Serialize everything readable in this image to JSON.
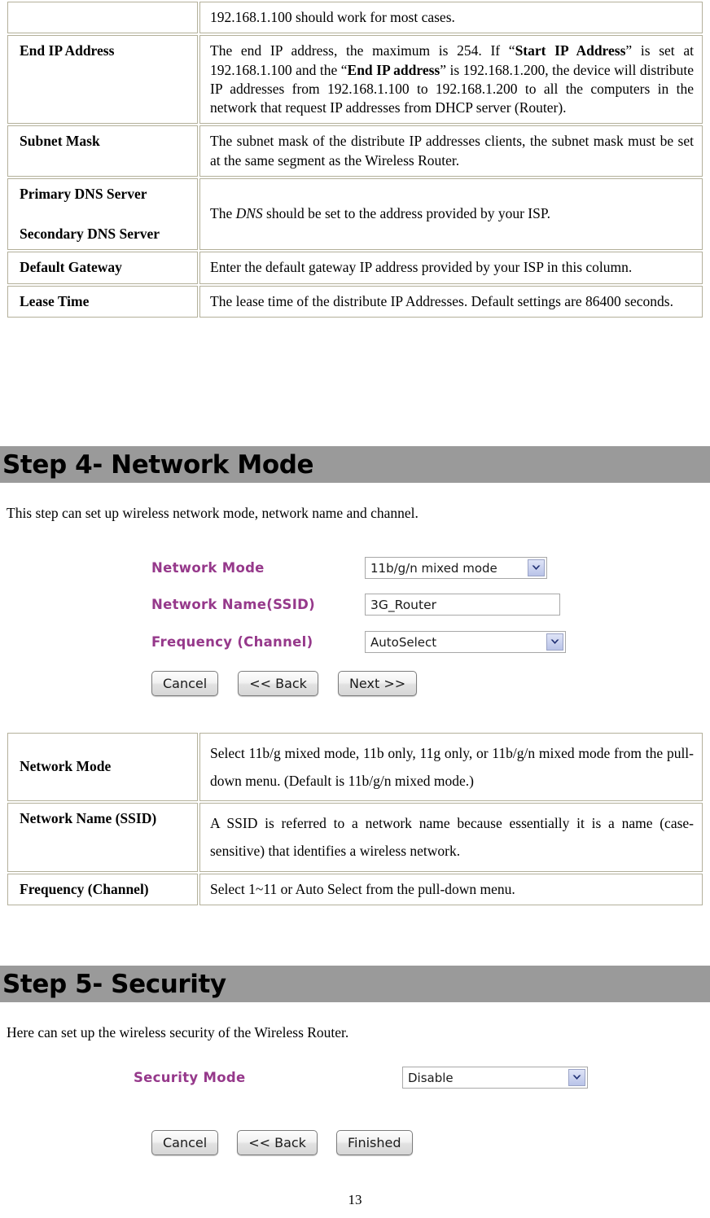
{
  "dhcp_table": {
    "rows": [
      {
        "label": "",
        "desc_html": "192.168.1.100 should work for most cases."
      },
      {
        "label": "End IP Address",
        "desc_html": "The end IP address, the maximum is 254. If “<b>Start IP Address</b>” is set at 192.168.1.100 and the “<b>End IP address</b>” is 192.168.1.200, the device will distribute IP addresses from 192.168.1.100 to 192.168.1.200 to all the computers in the network that request IP addresses from DHCP server (Router)."
      },
      {
        "label": "Subnet Mask",
        "desc_html": "The subnet mask of the distribute IP addresses clients, the subnet mask must be set at the same segment as the Wireless  Router."
      },
      {
        "label": "Primary DNS Server",
        "label2": "Secondary DNS Server",
        "desc_html": "The <i>DNS</i> should be set to the address provided by your ISP."
      },
      {
        "label": "Default Gateway",
        "desc_html": "Enter the default gateway IP address provided by your ISP in this column."
      },
      {
        "label": "Lease Time",
        "desc_html": "The lease time of the distribute IP Addresses. Default settings are 86400 seconds."
      }
    ]
  },
  "step4": {
    "heading": "Step 4- Network Mode",
    "intro": "This step can set up wireless network mode, network name and channel.",
    "form": {
      "network_mode_label": "Network Mode",
      "network_mode_value": "11b/g/n mixed mode",
      "ssid_label": "Network Name(SSID)",
      "ssid_value": "3G_Router",
      "frequency_label": "Frequency (Channel)",
      "frequency_value": "AutoSelect",
      "buttons": [
        "Cancel",
        "<<  Back",
        "Next  >>"
      ]
    },
    "table": {
      "rows": [
        {
          "label": "Network Mode",
          "desc_html": "Select 11b/g mixed mode, 11b only, 11g only, or 11b/g/n mixed mode from the pull-down menu. (Default is 11b/g/n mixed mode.)"
        },
        {
          "label": "Network Name (SSID)",
          "desc_html": "A SSID is referred to a network name because essentially it is a name (case-sensitive) that identifies a wireless network."
        },
        {
          "label": "Frequency (Channel)",
          "desc_html": "Select 1~11 or Auto Select from the pull-down menu."
        }
      ]
    }
  },
  "step5": {
    "heading": "Step 5- Security",
    "intro": "Here can set up the wireless security of the Wireless  Router.",
    "form": {
      "security_mode_label": "Security Mode",
      "security_mode_value": "Disable",
      "buttons": [
        "Cancel",
        "<<  Back",
        "Finished"
      ]
    }
  },
  "footer": {
    "page_number": "13"
  },
  "colors": {
    "step_bar_background": "#9a9a9a",
    "form_label": "#96398b",
    "table_border": "#b3b09a",
    "dropdown_arrow": "#1f2f73"
  }
}
